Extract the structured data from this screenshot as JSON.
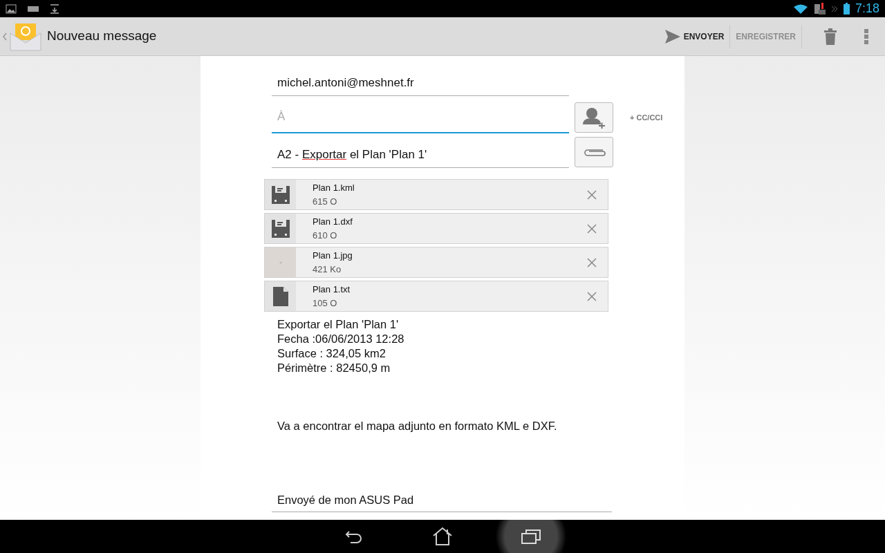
{
  "status_bar": {
    "time": "7:18"
  },
  "action_bar": {
    "title": "Nouveau message",
    "actions": [
      {
        "label": "ENVOYER",
        "disabled": false
      },
      {
        "label": "ENREGISTRER",
        "disabled": true
      }
    ]
  },
  "from": "michel.antoni@meshnet.fr",
  "to": {
    "placeholder": "À",
    "focused": true
  },
  "cc_link": "+ CC/CCI",
  "subject": [
    {
      "text": "A2 - ",
      "misspelled": false
    },
    {
      "text": "Exportar",
      "misspelled": true
    },
    {
      "text": " el Plan 'Plan 1'",
      "misspelled": false
    }
  ],
  "attachments": [
    {
      "kind": "disk",
      "name": "Plan 1.kml",
      "size": "615 O"
    },
    {
      "kind": "disk",
      "name": "Plan 1.dxf",
      "size": "610 O"
    },
    {
      "kind": "image",
      "name": "Plan 1.jpg",
      "size": "421 Ko"
    },
    {
      "kind": "document",
      "name": "Plan 1.txt",
      "size": "105 O"
    }
  ],
  "body": [
    "Exportar el Plan 'Plan 1'\nFecha :06/06/2013 12:28\nSurface : 324,05 km2\nPérimètre : 82450,9 m",
    "Va a encontrar el mapa adjunto en formato KML e DXF."
  ],
  "signature": "Envoyé de mon ASUS Pad"
}
